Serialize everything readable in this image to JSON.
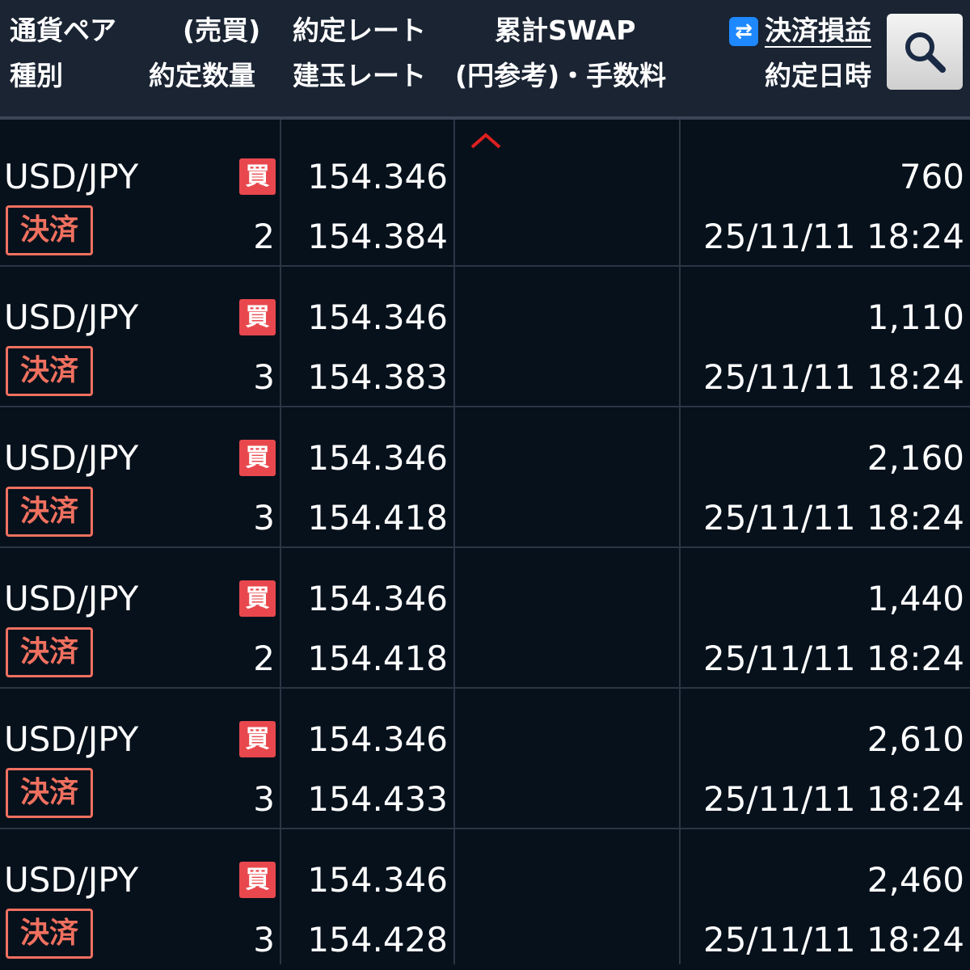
{
  "header": {
    "col1_line1": "通貨ペア",
    "col1_line2": "種別",
    "col2_line1": "(売買)",
    "col2_line2": "約定数量",
    "col3_line1": "約定レート",
    "col3_line2": "建玉レート",
    "col4_line1": "累計SWAP",
    "col4_line2": "(円参考)・手数料",
    "col5_line1": "決済損益",
    "col5_line2": "約定日時",
    "swap_toggle_icon": "swap-arrows-icon",
    "search_icon": "search-icon"
  },
  "colors": {
    "background": "#06111c",
    "header_background": "#1a2433",
    "buy_badge": "#e8484d",
    "settle_border": "#f0705f",
    "sort_caret": "#e02020",
    "toggle_icon": "#1e88ff"
  },
  "rows": [
    {
      "pair": "USD/JPY",
      "side": "買",
      "action": "決済",
      "qty": "2",
      "exec_rate": "154.346",
      "open_rate": "154.384",
      "swap": "",
      "pnl": "760",
      "datetime": "25/11/11 18:24"
    },
    {
      "pair": "USD/JPY",
      "side": "買",
      "action": "決済",
      "qty": "3",
      "exec_rate": "154.346",
      "open_rate": "154.383",
      "swap": "",
      "pnl": "1,110",
      "datetime": "25/11/11 18:24"
    },
    {
      "pair": "USD/JPY",
      "side": "買",
      "action": "決済",
      "qty": "3",
      "exec_rate": "154.346",
      "open_rate": "154.418",
      "swap": "",
      "pnl": "2,160",
      "datetime": "25/11/11 18:24"
    },
    {
      "pair": "USD/JPY",
      "side": "買",
      "action": "決済",
      "qty": "2",
      "exec_rate": "154.346",
      "open_rate": "154.418",
      "swap": "",
      "pnl": "1,440",
      "datetime": "25/11/11 18:24"
    },
    {
      "pair": "USD/JPY",
      "side": "買",
      "action": "決済",
      "qty": "3",
      "exec_rate": "154.346",
      "open_rate": "154.433",
      "swap": "",
      "pnl": "2,610",
      "datetime": "25/11/11 18:24"
    },
    {
      "pair": "USD/JPY",
      "side": "買",
      "action": "決済",
      "qty": "3",
      "exec_rate": "154.346",
      "open_rate": "154.428",
      "swap": "",
      "pnl": "2,460",
      "datetime": "25/11/11 18:24"
    }
  ]
}
